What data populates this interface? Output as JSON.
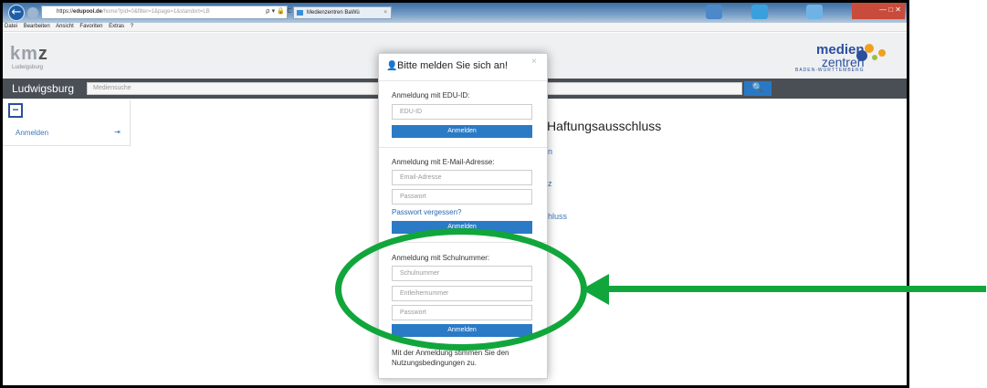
{
  "browser": {
    "address_prefix": "https://",
    "address_domain": "edupool.de",
    "address_rest": "/home?pid=0&filter=1&page=1&standort=LB",
    "address_icons": "ρ ▾ 🔒 C",
    "tab_title": "Medienzentren BaWü",
    "tab_close": "×",
    "window_controls": "— □ ✕",
    "menu": [
      "Datei",
      "Bearbeiten",
      "Ansicht",
      "Favoriten",
      "Extras",
      "?"
    ]
  },
  "site": {
    "kmz_logo_prefix": "km",
    "kmz_logo_z": "z",
    "kmz_subtitle": "Ludwigsburg",
    "mz_logo_line1": "medien",
    "mz_logo_line2": "zentren",
    "mz_logo_line3": "BADEN-WÜRTTEMBERG",
    "city": "Ludwigsburg",
    "search_placeholder": "Mediensuche",
    "search_icon": "🔍",
    "sidebar_toggle": "−",
    "sidebar_login": "Anmelden",
    "sidebar_login_icon": "⇥"
  },
  "background": {
    "heading_fragment": "Haftungsausschluss",
    "link1": "n",
    "link2": "z",
    "link3": "hluss"
  },
  "modal": {
    "title": "Bitte melden Sie sich an!",
    "close": "×",
    "edu": {
      "label": "Anmeldung mit EDU-ID:",
      "placeholder": "EDU-ID",
      "button": "Anmelden"
    },
    "email": {
      "label": "Anmeldung mit E-Mail-Adresse:",
      "email_placeholder": "Email-Adresse",
      "password_placeholder": "Passwort",
      "forgot": "Passwort vergessen?",
      "button": "Anmelden"
    },
    "school": {
      "label": "Anmeldung mit Schulnummer:",
      "school_placeholder": "Schulnummer",
      "borrower_placeholder": "Entleihernummer",
      "password_placeholder": "Passwort",
      "button": "Anmelden"
    },
    "footer": "Mit der Anmeldung stimmen Sie den Nutzungsbedingungen zu."
  },
  "colors": {
    "annotation": "#11a63b",
    "primary_button": "#2a7ac6",
    "navbar": "#4a4f55"
  }
}
